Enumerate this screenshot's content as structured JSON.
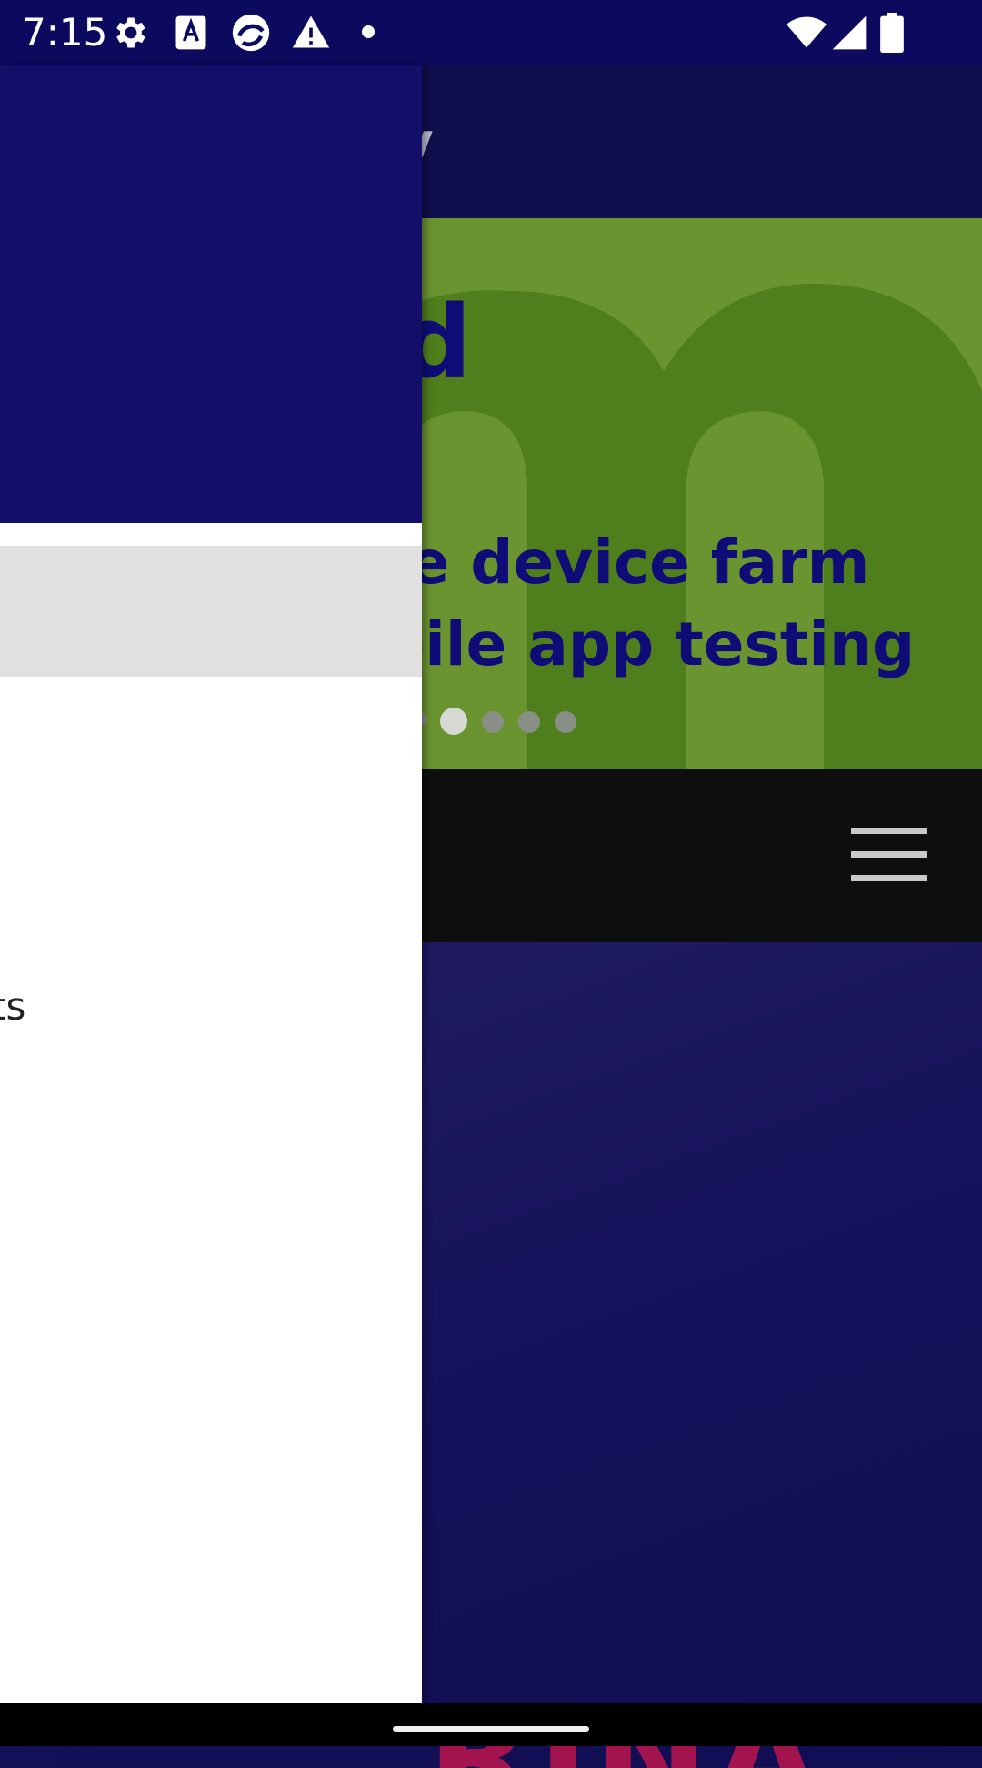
{
  "status_bar": {
    "time": "7:15",
    "icons": [
      "gear-icon",
      "text-a-icon",
      "swirl-app-icon",
      "warning-icon",
      "dot-icon",
      "wifi-icon",
      "cell-signal-icon",
      "battery-icon"
    ],
    "background": "#0b0a5e"
  },
  "app": {
    "header_partial_text": "v",
    "hero": {
      "big_partial": "d",
      "line1_partial": "te device farm",
      "line2_partial": "bile app testing",
      "background": "#6a9430",
      "text_color": "#0f0c78",
      "carousel_dots": 5,
      "active_dot_index": 1
    },
    "nav_bar": {
      "menu_icon": "hamburger-menu-icon",
      "background": "#0e0e0e"
    },
    "promo": {
      "partial_text": "RINA",
      "text_color": "#a3144f"
    }
  },
  "drawer": {
    "header_color": "#130e68",
    "selected_item_color": "#e0e0e0",
    "partial_item_text": "ts"
  }
}
